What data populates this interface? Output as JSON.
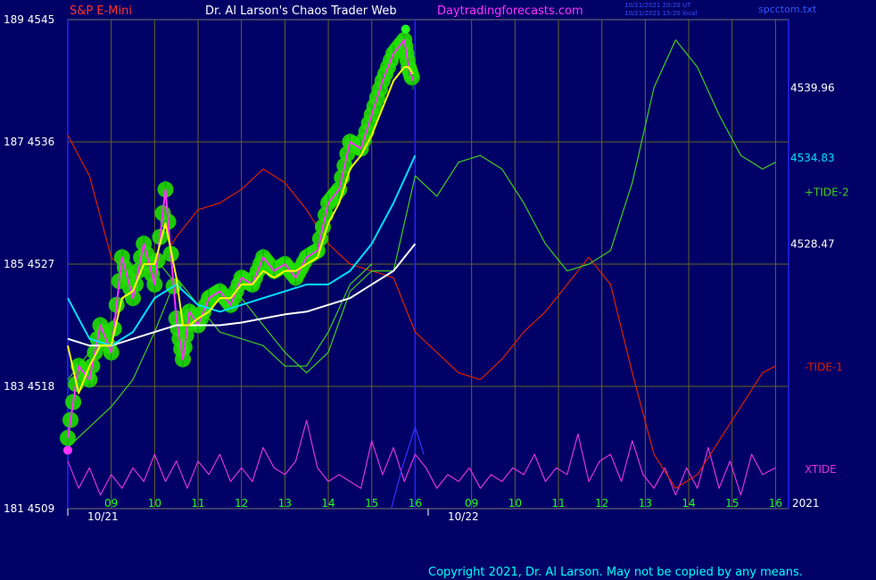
{
  "header": {
    "instrument": "S&P E-Mini",
    "author": "Dr. Al Larson's Chaos Trader Web",
    "site": "Daytradingforecasts.com",
    "utc_time": "10/21/2021 20:20 UT",
    "local_time": "10/21/2021 15:20 local",
    "file": "spcctom.txt"
  },
  "footer": {
    "copyright": "Copyright 2021, Dr. Al Larson. May not be copied by any means."
  },
  "colors": {
    "background": "#000066",
    "frame": "#2222ff",
    "grid": "#666622",
    "price_bubbles": "#22dd00",
    "price_bars": "#ff33ff",
    "fast_ma": "#ffff00",
    "mid_ma": "#00e0ff",
    "slow_ma": "#ffffff",
    "tide2": "#44cc22",
    "tide1": "#dd2200",
    "xtide": "#dd33dd",
    "channel": "#44cc22",
    "timing_line": "#3333ff"
  },
  "chart_data": {
    "type": "line",
    "y_axis": {
      "range": [
        4509,
        4545
      ],
      "ticks": [
        {
          "value": 4545,
          "label": "189  4545"
        },
        {
          "value": 4536,
          "label": "187  4536"
        },
        {
          "value": 4527,
          "label": "185  4527"
        },
        {
          "value": 4518,
          "label": "183  4518"
        },
        {
          "value": 4509,
          "label": "181  4509"
        }
      ]
    },
    "x_axis": {
      "range_hours": [
        8,
        16.3
      ],
      "day_split_hour": 16,
      "hour_labels": [
        {
          "day": 1,
          "label": "09"
        },
        {
          "day": 1,
          "label": "10"
        },
        {
          "day": 1,
          "label": "11"
        },
        {
          "day": 1,
          "label": "12"
        },
        {
          "day": 1,
          "label": "13"
        },
        {
          "day": 1,
          "label": "14"
        },
        {
          "day": 1,
          "label": "15"
        },
        {
          "day": 1,
          "label": "16"
        },
        {
          "day": 2,
          "label": "09"
        },
        {
          "day": 2,
          "label": "10"
        },
        {
          "day": 2,
          "label": "11"
        },
        {
          "day": 2,
          "label": "12"
        },
        {
          "day": 2,
          "label": "13"
        },
        {
          "day": 2,
          "label": "14"
        },
        {
          "day": 2,
          "label": "15"
        },
        {
          "day": 2,
          "label": "16"
        }
      ],
      "date_labels": [
        "10/21",
        "10/22"
      ],
      "year_label": "2021"
    },
    "right_labels": [
      {
        "value": 4539.96,
        "text": "4539.96",
        "color": "#ffffff"
      },
      {
        "value": 4534.83,
        "text": "4534.83",
        "color": "#00e0ff"
      },
      {
        "value": 4528.47,
        "text": "4528.47",
        "color": "#ffffff"
      }
    ],
    "series_labels": [
      {
        "name": "+TIDE-2",
        "color": "#44cc22"
      },
      {
        "name": "-TIDE-1",
        "color": "#dd2200"
      },
      {
        "name": "XTIDE",
        "color": "#dd33dd"
      }
    ],
    "price": {
      "x": [
        8.0,
        8.25,
        8.5,
        8.75,
        9.0,
        9.25,
        9.5,
        9.75,
        10.0,
        10.25,
        10.5,
        10.65,
        10.8,
        11.0,
        11.25,
        11.5,
        11.75,
        12.0,
        12.25,
        12.5,
        12.75,
        13.0,
        13.25,
        13.5,
        13.75,
        14.0,
        14.25,
        14.5,
        14.75,
        15.0,
        15.25,
        15.5,
        15.75,
        15.85,
        15.95
      ],
      "y": [
        4514.2,
        4519.5,
        4518.5,
        4522.5,
        4520.5,
        4527.5,
        4524.5,
        4528.5,
        4525.5,
        4532.5,
        4523.0,
        4520.0,
        4523.5,
        4522.5,
        4524.5,
        4525.0,
        4524.0,
        4526.0,
        4525.5,
        4527.5,
        4526.5,
        4527.0,
        4526.0,
        4527.5,
        4528.0,
        4531.5,
        4532.5,
        4536.0,
        4535.5,
        4538.0,
        4540.5,
        4542.5,
        4543.5,
        4541.5,
        4540.5
      ]
    },
    "fast_ma": {
      "x": [
        8.0,
        8.25,
        8.5,
        8.75,
        9.0,
        9.25,
        9.5,
        9.75,
        10.0,
        10.25,
        10.5,
        10.65,
        10.8,
        11.0,
        11.25,
        11.5,
        11.75,
        12.0,
        12.25,
        12.5,
        12.75,
        13.0,
        13.25,
        13.5,
        13.75,
        14.0,
        14.25,
        14.5,
        14.75,
        15.0,
        15.25,
        15.5,
        15.75,
        15.85,
        15.95
      ],
      "y": [
        4521.0,
        4517.5,
        4519.5,
        4521.0,
        4521.0,
        4524.5,
        4525.0,
        4527.0,
        4527.0,
        4530.0,
        4526.0,
        4522.5,
        4522.5,
        4523.0,
        4523.5,
        4524.5,
        4524.5,
        4525.5,
        4525.5,
        4526.5,
        4526.0,
        4526.5,
        4526.5,
        4527.0,
        4527.5,
        4530.0,
        4531.5,
        4534.0,
        4535.0,
        4536.5,
        4538.5,
        4540.5,
        4541.5,
        4541.5,
        4541.0
      ]
    },
    "mid_ma": {
      "x": [
        8.0,
        8.5,
        9.0,
        9.5,
        10.0,
        10.5,
        11.0,
        11.5,
        12.0,
        12.5,
        13.0,
        13.5,
        14.0,
        14.5,
        15.0,
        15.5,
        16.0
      ],
      "y": [
        4524.5,
        4521.5,
        4521.0,
        4522.0,
        4524.5,
        4525.5,
        4524.0,
        4523.5,
        4524.0,
        4524.5,
        4525.0,
        4525.5,
        4525.5,
        4526.5,
        4528.5,
        4531.5,
        4535.0
      ]
    },
    "slow_ma": {
      "x": [
        8.0,
        8.5,
        9.0,
        9.5,
        10.0,
        10.5,
        11.0,
        11.5,
        12.0,
        12.5,
        13.0,
        13.5,
        14.0,
        14.5,
        15.0,
        15.5,
        16.0
      ],
      "y": [
        4521.5,
        4521.0,
        4521.0,
        4521.5,
        4522.0,
        4522.5,
        4522.5,
        4522.5,
        4522.7,
        4523.0,
        4523.3,
        4523.5,
        4524.0,
        4524.5,
        4525.5,
        4526.5,
        4528.5
      ]
    },
    "channel_low": {
      "x": [
        8.0,
        8.5,
        9.0,
        9.5,
        10.0,
        10.5,
        11.0,
        11.5,
        12.0,
        12.5,
        13.0,
        13.5,
        14.0,
        14.5,
        15.0
      ],
      "y": [
        4513.5,
        4515.0,
        4516.5,
        4518.5,
        4522.0,
        4526.0,
        4524.0,
        4522.0,
        4521.5,
        4521.0,
        4519.5,
        4519.5,
        4522.0,
        4525.5,
        4527.0
      ]
    },
    "timing_line": {
      "x": [
        15.45,
        15.7,
        16.0,
        16.2
      ],
      "y": [
        4509,
        4512,
        4515,
        4513
      ]
    },
    "tide2": {
      "x": [
        8.0,
        8.5,
        9.0,
        9.5,
        10.0,
        10.5,
        11.0,
        11.5,
        12.0,
        12.5,
        13.0,
        13.5,
        14.0,
        14.5,
        15.0,
        15.5,
        16.0,
        16.5,
        17.0,
        17.5,
        18.0,
        18.5,
        19.0,
        19.5,
        20.0,
        20.5,
        21.0,
        21.5,
        22.0,
        22.5,
        23.0,
        23.5,
        24.0,
        24.3
      ],
      "y": [
        4518.5,
        4520.5,
        4522.5,
        4526.0,
        4527.5,
        4525.5,
        4524.0,
        4525.0,
        4524.5,
        4522.5,
        4520.5,
        4519.0,
        4520.5,
        4525.0,
        4526.5,
        4526.5,
        4533.5,
        4532.0,
        4534.5,
        4535.0,
        4534.0,
        4531.5,
        4528.5,
        4526.5,
        4527.0,
        4528.0,
        4533.0,
        4540.0,
        4543.5,
        4541.5,
        4538.0,
        4535.0,
        4534.0,
        4534.5
      ]
    },
    "tide1": {
      "x": [
        8.0,
        8.5,
        9.0,
        9.5,
        10.0,
        10.5,
        11.0,
        11.5,
        12.0,
        12.5,
        13.0,
        13.5,
        14.0,
        14.5,
        15.0,
        15.5,
        16.0,
        16.5,
        17.0,
        17.5,
        18.0,
        18.5,
        19.0,
        19.5,
        20.0,
        20.5,
        21.0,
        21.5,
        22.0,
        22.5,
        23.0,
        23.5,
        24.0,
        24.3
      ],
      "y": [
        4536.5,
        4533.5,
        4527.5,
        4526.0,
        4526.5,
        4529.0,
        4531.0,
        4531.5,
        4532.5,
        4534.0,
        4533.0,
        4531.0,
        4528.5,
        4527.0,
        4526.5,
        4526.0,
        4522.0,
        4520.5,
        4519.0,
        4518.5,
        4520.0,
        4522.0,
        4523.5,
        4525.5,
        4527.5,
        4525.5,
        4519.0,
        4513.0,
        4510.5,
        4511.5,
        4514.0,
        4516.5,
        4519.0,
        4519.5
      ]
    },
    "xtide": {
      "x": [
        8.0,
        8.25,
        8.5,
        8.75,
        9.0,
        9.25,
        9.5,
        9.75,
        10.0,
        10.25,
        10.5,
        10.75,
        11.0,
        11.25,
        11.5,
        11.75,
        12.0,
        12.25,
        12.5,
        12.75,
        13.0,
        13.25,
        13.5,
        13.75,
        14.0,
        14.25,
        14.5,
        14.75,
        15.0,
        15.25,
        15.5,
        15.75,
        16.0,
        16.25,
        16.5,
        16.75,
        17.0,
        17.25,
        17.5,
        17.75,
        18.0,
        18.25,
        18.5,
        18.75,
        19.0,
        19.25,
        19.5,
        19.75,
        20.0,
        20.25,
        20.5,
        20.75,
        21.0,
        21.25,
        21.5,
        21.75,
        22.0,
        22.25,
        22.5,
        22.75,
        23.0,
        23.25,
        23.5,
        23.75,
        24.0,
        24.3
      ],
      "y": [
        4512.5,
        4510.5,
        4512.0,
        4510.0,
        4511.5,
        4510.5,
        4512.0,
        4511.0,
        4513.0,
        4511.0,
        4512.5,
        4510.5,
        4512.5,
        4511.5,
        4513.0,
        4511.0,
        4512.0,
        4511.0,
        4513.5,
        4512.0,
        4511.5,
        4512.5,
        4515.5,
        4512.0,
        4511.0,
        4511.5,
        4511.0,
        4510.5,
        4514.0,
        4511.5,
        4513.5,
        4511.0,
        4513.0,
        4512.0,
        4510.5,
        4511.5,
        4511.0,
        4512.0,
        4510.5,
        4511.5,
        4511.0,
        4512.0,
        4511.5,
        4513.0,
        4511.0,
        4512.0,
        4511.5,
        4514.5,
        4511.0,
        4512.5,
        4513.0,
        4511.0,
        4514.0,
        4511.5,
        4510.5,
        4512.0,
        4510.0,
        4512.0,
        4510.5,
        4513.5,
        4510.5,
        4512.5,
        4510.0,
        4513.0,
        4511.5,
        4512.0
      ]
    },
    "markers": [
      {
        "name": "high-dot",
        "x": 15.78,
        "y": 4544.3,
        "color": "#22ff22"
      },
      {
        "name": "low-dot",
        "x": 8.0,
        "y": 4513.3,
        "color": "#ff33ff"
      }
    ]
  }
}
